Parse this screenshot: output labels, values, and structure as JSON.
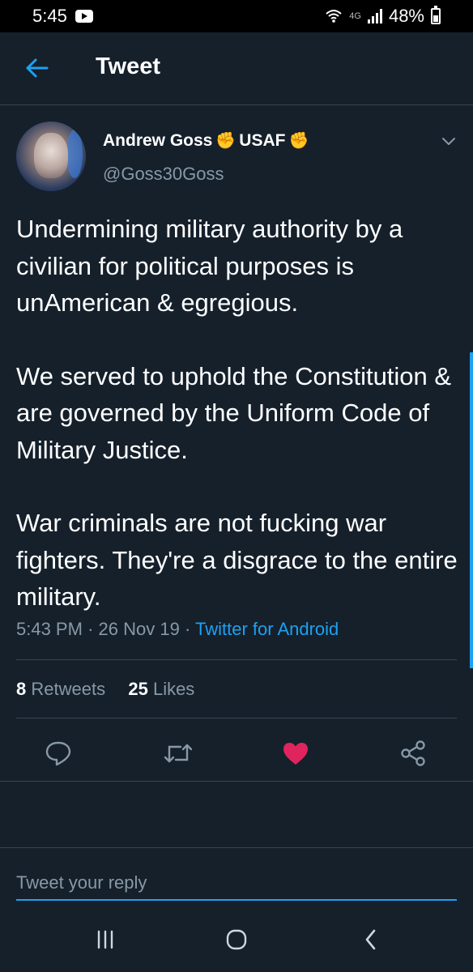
{
  "status_bar": {
    "time": "5:45",
    "network": "4G",
    "battery": "48%"
  },
  "header": {
    "title": "Tweet"
  },
  "tweet": {
    "author_name": "Andrew Goss",
    "author_badge": "USAF",
    "handle": "@Goss30Goss",
    "paragraphs": [
      "Undermining military authority by a civilian for political purposes is unAmerican & egregious.",
      "We served to uphold the Constitution & are governed by the Uniform Code of Military Justice.",
      "War criminals are not fucking war fighters. They're a disgrace to the entire military."
    ],
    "time": "5:43 PM",
    "date": "26 Nov 19",
    "source": "Twitter for Android",
    "retweets_count": "8",
    "retweets_label": "Retweets",
    "likes_count": "25",
    "likes_label": "Likes",
    "liked": true
  },
  "reply": {
    "placeholder": "Tweet your reply"
  },
  "colors": {
    "background": "#15202b",
    "accent": "#1da1f2",
    "secondary_text": "#8899a6",
    "like": "#e0245e",
    "divider": "#38444d"
  },
  "icons": {
    "back": "arrow-left-icon",
    "caret": "chevron-down-icon",
    "reply": "comment-icon",
    "retweet": "retweet-icon",
    "like": "heart-icon",
    "share": "share-icon",
    "badge": "fist-emoji-icon"
  }
}
